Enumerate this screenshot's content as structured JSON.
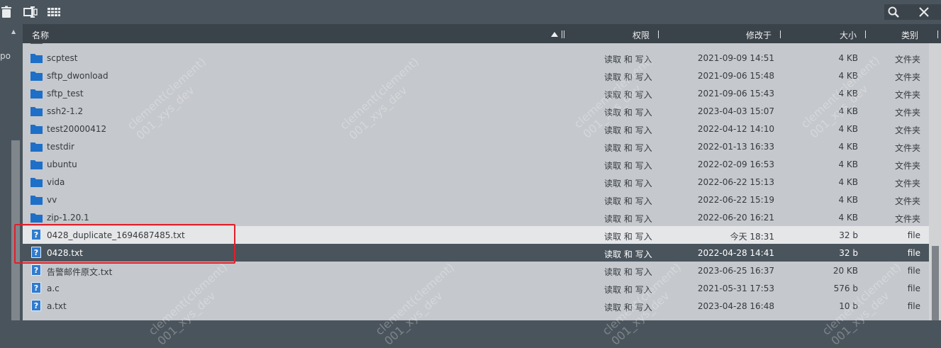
{
  "toolbar": {
    "icons": [
      "trash-icon",
      "rename-icon",
      "grid-view-icon",
      "search-icon",
      "close-icon"
    ]
  },
  "sidebar": {
    "partial_text": "po"
  },
  "columns": {
    "name": "名称",
    "permissions": "权限",
    "modified": "修改于",
    "size": "大小",
    "type": "类别"
  },
  "watermark": {
    "line1": "clement(clement)",
    "line2": "001_xys_dev"
  },
  "files": [
    {
      "name": "scptest",
      "perm": "读取 和 写入",
      "date": "2021-09-09 14:51",
      "size": "4 KB",
      "type": "文件夹",
      "kind": "folder"
    },
    {
      "name": "sftp_dwonload",
      "perm": "读取 和 写入",
      "date": "2021-09-06 15:48",
      "size": "4 KB",
      "type": "文件夹",
      "kind": "folder"
    },
    {
      "name": "sftp_test",
      "perm": "读取 和 写入",
      "date": "2021-09-06 15:43",
      "size": "4 KB",
      "type": "文件夹",
      "kind": "folder"
    },
    {
      "name": "ssh2-1.2",
      "perm": "读取 和 写入",
      "date": "2023-04-03 15:07",
      "size": "4 KB",
      "type": "文件夹",
      "kind": "folder"
    },
    {
      "name": "test20000412",
      "perm": "读取 和 写入",
      "date": "2022-04-12 14:10",
      "size": "4 KB",
      "type": "文件夹",
      "kind": "folder"
    },
    {
      "name": "testdir",
      "perm": "读取 和 写入",
      "date": "2022-01-13 16:33",
      "size": "4 KB",
      "type": "文件夹",
      "kind": "folder"
    },
    {
      "name": "ubuntu",
      "perm": "读取 和 写入",
      "date": "2022-02-09 16:53",
      "size": "4 KB",
      "type": "文件夹",
      "kind": "folder"
    },
    {
      "name": "vida",
      "perm": "读取 和 写入",
      "date": "2022-06-22 15:13",
      "size": "4 KB",
      "type": "文件夹",
      "kind": "folder"
    },
    {
      "name": "vv",
      "perm": "读取 和 写入",
      "date": "2022-06-22 15:19",
      "size": "4 KB",
      "type": "文件夹",
      "kind": "folder"
    },
    {
      "name": "zip-1.20.1",
      "perm": "读取 和 写入",
      "date": "2022-06-20 16:21",
      "size": "4 KB",
      "type": "文件夹",
      "kind": "folder"
    },
    {
      "name": "0428_duplicate_1694687485.txt",
      "perm": "读取 和 写入",
      "date": "今天 18:31",
      "size": "32 b",
      "type": "file",
      "kind": "file",
      "state": "hover"
    },
    {
      "name": "0428.txt",
      "perm": "读取 和 写入",
      "date": "2022-04-28 14:41",
      "size": "32 b",
      "type": "file",
      "kind": "file",
      "state": "selected"
    },
    {
      "name": "告警邮件原文.txt",
      "perm": "读取 和 写入",
      "date": "2023-06-25 16:37",
      "size": "20 KB",
      "type": "file",
      "kind": "file"
    },
    {
      "name": "a.c",
      "perm": "读取 和 写入",
      "date": "2021-05-31 17:53",
      "size": "576 b",
      "type": "file",
      "kind": "file"
    },
    {
      "name": "a.txt",
      "perm": "读取 和 写入",
      "date": "2023-04-28 16:48",
      "size": "10 b",
      "type": "file",
      "kind": "file"
    }
  ],
  "colors": {
    "toolbar_bg": "#4a545c",
    "header_bg": "#3b434a",
    "list_bg": "#c5c8cc",
    "folder_icon": "#1e6fc8",
    "selected_row": "#4a545c",
    "highlight_box": "#e0202a"
  }
}
